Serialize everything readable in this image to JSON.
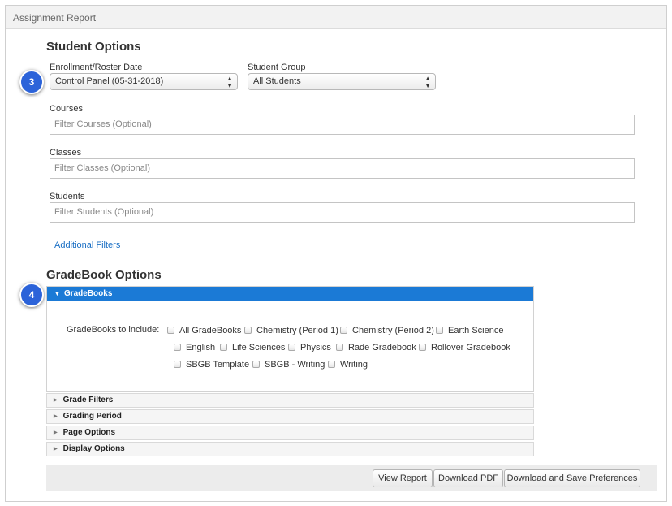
{
  "window": {
    "title": "Assignment Report"
  },
  "student_options": {
    "heading": "Student Options",
    "enrollment": {
      "label": "Enrollment/Roster Date",
      "value": "Control Panel (05-31-2018)"
    },
    "group": {
      "label": "Student Group",
      "value": "All Students"
    },
    "courses": {
      "label": "Courses",
      "placeholder": "Filter Courses (Optional)"
    },
    "classes": {
      "label": "Classes",
      "placeholder": "Filter Classes (Optional)"
    },
    "students": {
      "label": "Students",
      "placeholder": "Filter Students (Optional)"
    },
    "additional_filters": "Additional Filters"
  },
  "gradebook_options": {
    "heading": "GradeBook Options",
    "panel_title": "GradeBooks",
    "include_label": "GradeBooks to include:",
    "gradebooks": [
      "All GradeBooks",
      "Chemistry (Period 1)",
      "Chemistry (Period 2)",
      "Earth Science",
      "English",
      "Life Sciences",
      "Physics",
      "Rade Gradebook",
      "Rollover Gradebook",
      "SBGB Template",
      "SBGB - Writing",
      "Writing"
    ],
    "sections": [
      "Grade Filters",
      "Grading Period",
      "Page Options",
      "Display Options"
    ]
  },
  "badges": {
    "step_a": "3",
    "step_b": "4"
  },
  "buttons": {
    "view_report": "View Report",
    "download_pdf": "Download PDF",
    "download_save": "Download and Save Preferences"
  },
  "colors": {
    "accent": "#1b7ad6",
    "badge": "#2c63d9",
    "link": "#1a6fc4"
  }
}
